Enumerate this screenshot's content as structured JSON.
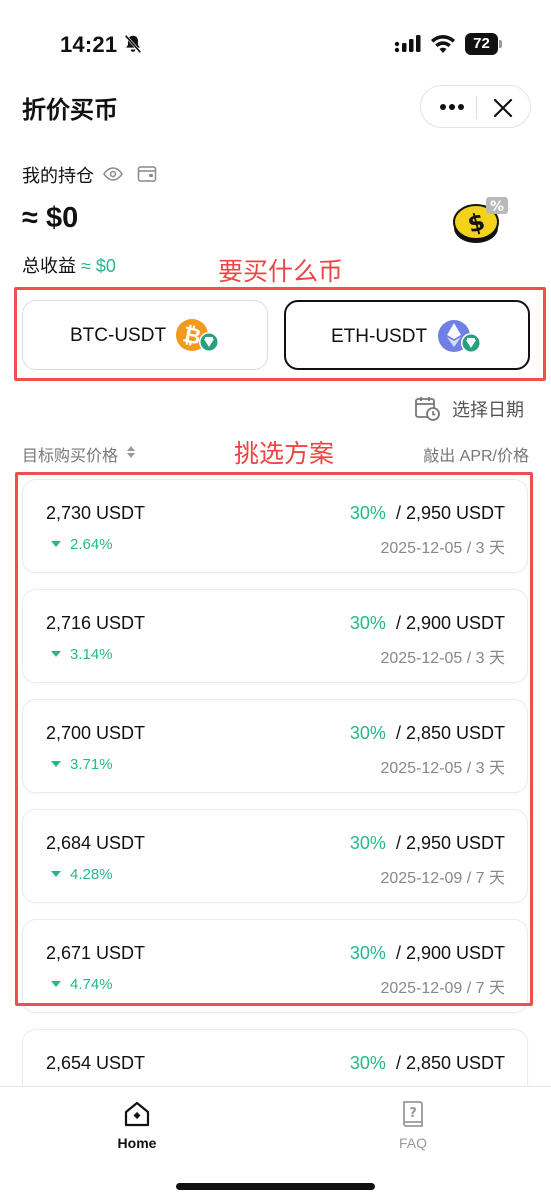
{
  "status_bar": {
    "time": "14:21",
    "battery": "72"
  },
  "header": {
    "title": "折价买币"
  },
  "holdings": {
    "label": "我的持仓",
    "amount": "≈ $0",
    "profit_label": "总收益",
    "profit_value": "≈ $0"
  },
  "annotations": {
    "choose_coin": "要买什么币",
    "choose_plan": "挑选方案"
  },
  "pairs": [
    {
      "label": "BTC-USDT",
      "icon": "btc-usdt-icon",
      "selected": false
    },
    {
      "label": "ETH-USDT",
      "icon": "eth-usdt-icon",
      "selected": true
    }
  ],
  "date_select": {
    "label": "选择日期"
  },
  "list_header": {
    "left": "目标购买价格",
    "right": "敲出 APR/价格"
  },
  "offers": [
    {
      "price": "2,730 USDT",
      "change": "2.64%",
      "apr": "30%",
      "strike": "/ 2,950 USDT",
      "date": "2025-12-05 / 3 天"
    },
    {
      "price": "2,716 USDT",
      "change": "3.14%",
      "apr": "30%",
      "strike": "/ 2,900 USDT",
      "date": "2025-12-05 / 3 天"
    },
    {
      "price": "2,700 USDT",
      "change": "3.71%",
      "apr": "30%",
      "strike": "/ 2,850 USDT",
      "date": "2025-12-05 / 3 天"
    },
    {
      "price": "2,684 USDT",
      "change": "4.28%",
      "apr": "30%",
      "strike": "/ 2,950 USDT",
      "date": "2025-12-09 / 7 天"
    },
    {
      "price": "2,671 USDT",
      "change": "4.74%",
      "apr": "30%",
      "strike": "/ 2,900 USDT",
      "date": "2025-12-09 / 7 天"
    },
    {
      "price": "2,654 USDT",
      "change": "",
      "apr": "30%",
      "strike": "/ 2,850 USDT",
      "date": ""
    }
  ],
  "tabbar": {
    "home_label": "Home",
    "faq_label": "FAQ"
  },
  "colors": {
    "accent_green": "#26b987",
    "annotation_red": "#ef4f4f"
  }
}
